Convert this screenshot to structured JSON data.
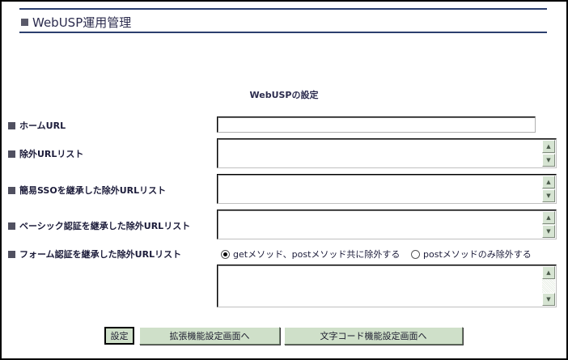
{
  "header": {
    "title": "WebUSP運用管理"
  },
  "section_title": "WebUSPの設定",
  "fields": {
    "home_url": {
      "label": "ホームURL",
      "value": ""
    },
    "exclude_url_list": {
      "label": "除外URLリスト",
      "value": ""
    },
    "sso_exclude_list": {
      "label": "簡易SSOを継承した除外URLリスト",
      "value": ""
    },
    "basic_auth_exclude_list": {
      "label": "ベーシック認証を継承した除外URLリスト",
      "value": ""
    },
    "form_auth_exclude_list": {
      "label": "フォーム認証を継承した除外URLリスト",
      "value": "",
      "options": {
        "get_post": "getメソッド、postメソッド共に除外する",
        "post_only": "postメソッドのみ除外する"
      },
      "selected": "get_post"
    }
  },
  "buttons": {
    "save": "設定",
    "extended_settings": "拡張機能設定画面へ",
    "charcode_settings": "文字コード機能設定画面へ"
  },
  "colors": {
    "accent": "#2c3f6e",
    "button_bg": "#cfe0c9"
  }
}
